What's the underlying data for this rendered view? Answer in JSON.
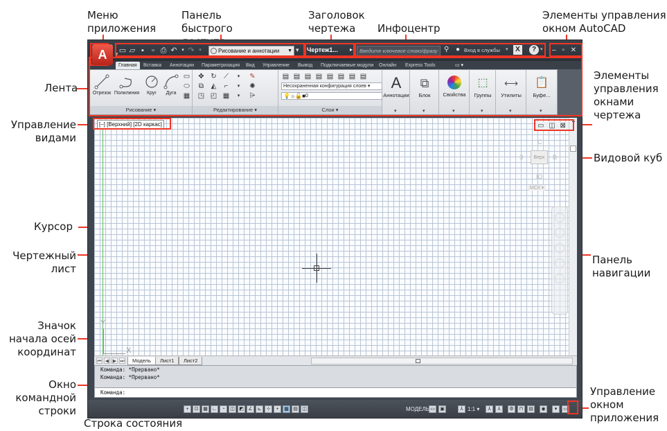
{
  "annotations": {
    "app_menu": "Меню приложения",
    "quick_access": "Панель быстрого доступа",
    "drawing_title": "Заголовок чертежа",
    "infocenter": "Инфоцентр",
    "window_controls": "Элементы управления окном AutoCAD",
    "ribbon": "Лента",
    "drawing_window_controls": "Элементы управления окнами чертежа",
    "view_controls": "Управление видами",
    "viewcube": "Видовой куб",
    "cursor": "Курсор",
    "drawing_sheet": "Чертежный лист",
    "navigation_bar": "Панель навигации",
    "ucs_icon": "Значок начала осей координат",
    "command_window": "Окно командной строки",
    "app_status_control": "Управление окном приложения",
    "status_bar": "Строка состояния"
  },
  "titlebar": {
    "app_button": "A",
    "workspace": "Рисование и аннотации",
    "drawing_title": "Чертеж1...",
    "search_placeholder": "Введите ключевое слово/фразу",
    "signin": "Вход в службы",
    "help": "?",
    "exchange": "X",
    "window_controls": "– ▫ ✕"
  },
  "ribbon_tabs": [
    "Главная",
    "Вставка",
    "Аннотации",
    "Параметризация",
    "Вид",
    "Управление",
    "Вывод",
    "Подключаемые модули",
    "Онлайн",
    "Express Tools"
  ],
  "ribbon": {
    "draw": {
      "title": "Рисование",
      "tools": [
        "Отрезок",
        "Полилиния",
        "Круг",
        "Дуга"
      ]
    },
    "modify": {
      "title": "Редактирование"
    },
    "layers": {
      "title": "Слои",
      "combo": "Несохраненная конфигурация слоев",
      "current_layer": "0"
    },
    "annotation": {
      "label": "Аннотации"
    },
    "block": {
      "label": "Блок"
    },
    "properties": {
      "label": "Свойства"
    },
    "groups": {
      "label": "Группы"
    },
    "utilities": {
      "label": "Утилиты"
    },
    "clipboard": {
      "label": "Буфе..."
    }
  },
  "drawing": {
    "view_control": "[–] [Верхний] [2D каркас]",
    "drawing_controls": "▭ ◫ ⊠",
    "viewcube": {
      "n": "С",
      "s": "Ю",
      "w": "З",
      "e": "В",
      "face": "Верх",
      "wcs": "МСК ▾"
    },
    "ucs": {
      "x": "X",
      "y": "Y"
    }
  },
  "layout_tabs": [
    "Модель",
    "Лист1",
    "Лист2"
  ],
  "command_line": {
    "history": [
      "Команда: *Прервано*",
      "Команда: *Прервано*"
    ],
    "prompt": "Команда:"
  },
  "status_bar": {
    "model": "МОДЕЛЬ",
    "scale": "1:1 ▾"
  }
}
